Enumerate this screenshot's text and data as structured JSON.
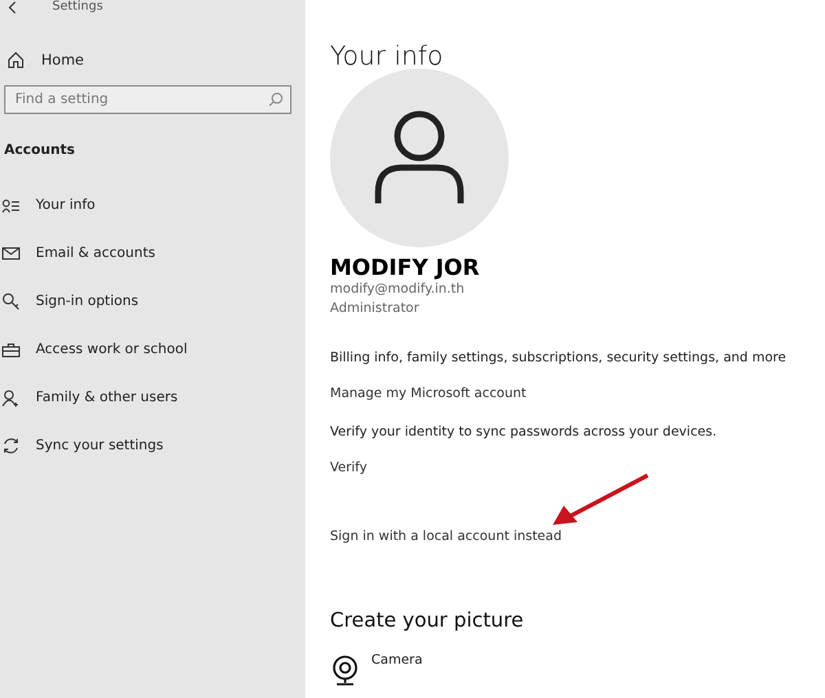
{
  "window": {
    "title": "Settings"
  },
  "sidebar": {
    "home": "Home",
    "search": {
      "placeholder": "Find a setting"
    },
    "section": "Accounts",
    "items": [
      {
        "label": "Your info"
      },
      {
        "label": "Email & accounts"
      },
      {
        "label": "Sign-in options"
      },
      {
        "label": "Access work or school"
      },
      {
        "label": "Family & other users"
      },
      {
        "label": "Sync your settings"
      }
    ]
  },
  "main": {
    "heading": "Your info",
    "name": "MODIFY JOR",
    "email": "modify@modify.in.th",
    "role": "Administrator",
    "billing_text": "Billing info, family settings, subscriptions, security settings, and more",
    "manage_link": "Manage my Microsoft account",
    "verify_text": "Verify your identity to sync passwords across your devices.",
    "verify_link": "Verify",
    "local_link": "Sign in with a local account instead",
    "picture_heading": "Create your picture",
    "camera": "Camera"
  }
}
